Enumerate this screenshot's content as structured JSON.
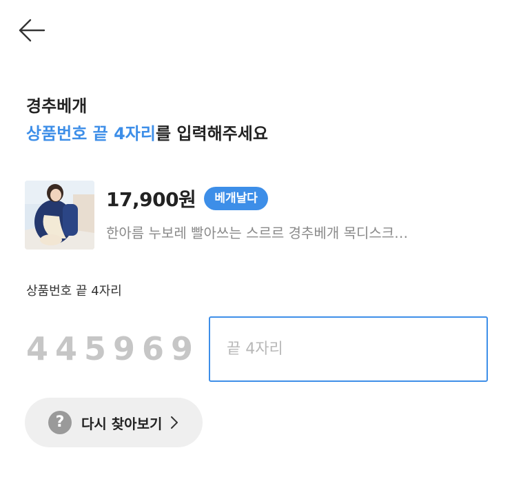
{
  "header": {
    "back_icon": "arrow-left-icon"
  },
  "heading": {
    "category": "경추베개",
    "instruction_highlight": "상품번호 끝 4자리",
    "instruction_rest": "를 입력해주세요",
    "accent_color": "#3d8ee8"
  },
  "product": {
    "price": "17,900원",
    "badge": "베개날다",
    "name": "한아름 누보레 빨아쓰는 스르르 경추베개 목디스크…"
  },
  "form": {
    "label": "상품번호 끝 4자리",
    "code_display": "445969",
    "input_value": "",
    "input_placeholder": "끝 4자리"
  },
  "retry": {
    "icon": "question-circle-icon",
    "icon_glyph": "?",
    "label": "다시 찾아보기",
    "chevron_icon": "chevron-right-icon"
  }
}
